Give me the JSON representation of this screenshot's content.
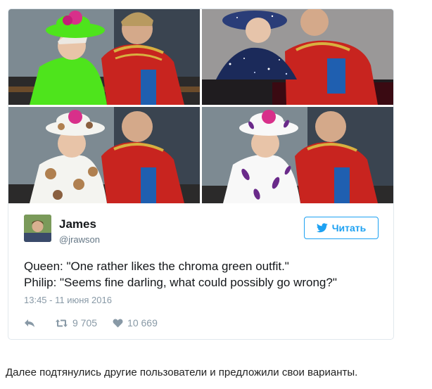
{
  "tweet": {
    "author_name": "James",
    "author_handle": "@jrawson",
    "follow_label": "Читать",
    "text_line1": "Queen: \"One rather likes the chroma green outfit.\"",
    "text_line2": "Philip: \"Seems fine darling, what could possibly go wrong?\"",
    "timestamp": "13:45 - 11 июня 2016",
    "retweet_count": "9 705",
    "like_count": "10 669",
    "photos": [
      {
        "outfit": "chroma green",
        "outfit_color": "#4ee41c"
      },
      {
        "outfit": "galaxy starfield",
        "outfit_color": "#1b2a5a"
      },
      {
        "outfit": "cats pattern",
        "outfit_color": "#f4f4f0"
      },
      {
        "outfit": "eggplant pattern",
        "outfit_color": "#f8f8f8"
      }
    ]
  },
  "caption": "Далее подтянулись другие пользователи и предложили свои варианты.",
  "colors": {
    "accent": "#1da1f2",
    "uniform_red": "#c8241f",
    "border": "#e1e8ed"
  }
}
